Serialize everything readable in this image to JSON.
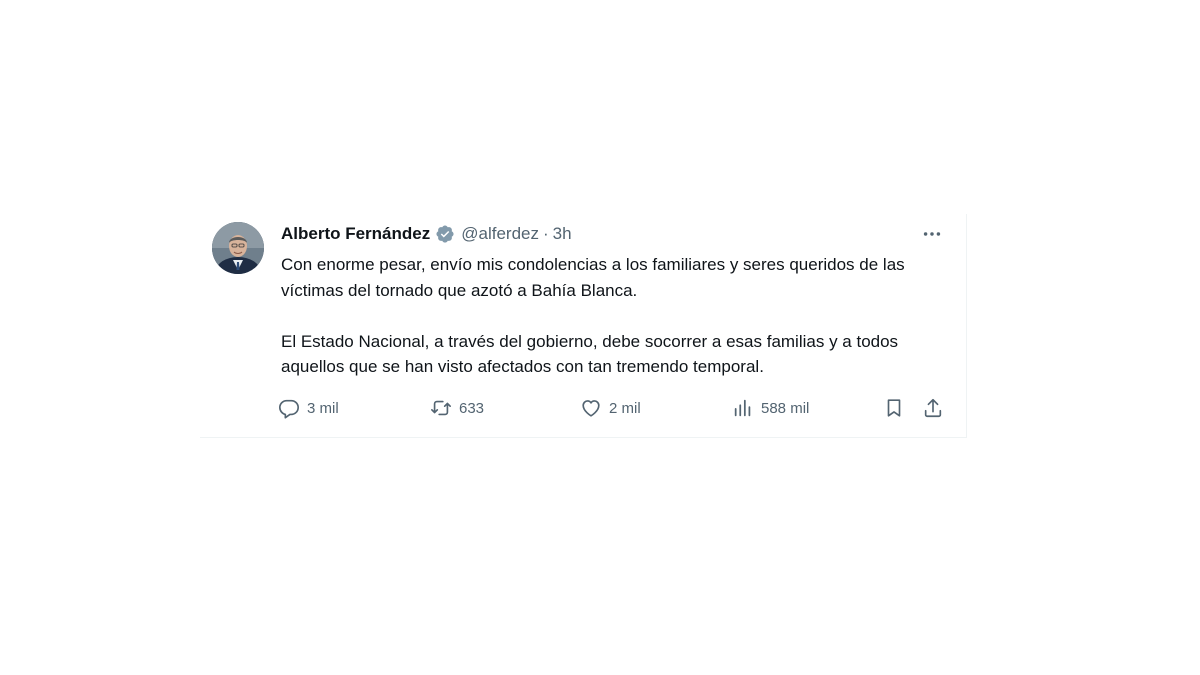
{
  "tweet": {
    "author_name": "Alberto Fernández",
    "handle": "@alferdez",
    "separator": "·",
    "time": "3h",
    "paragraphs": [
      "Con enorme pesar, envío mis condolencias a los familiares y seres queridos de las víctimas del tornado que azotó a Bahía Blanca.",
      "El Estado Nacional, a través del gobierno, debe socorrer a esas familias y a todos aquellos que se han visto afectados con tan tremendo temporal."
    ],
    "actions": {
      "replies": "3 mil",
      "retweets": "633",
      "likes": "2 mil",
      "views": "588 mil"
    }
  },
  "icons": {
    "verified": "verified-badge-icon",
    "more": "more-options-icon",
    "reply": "reply-icon",
    "retweet": "retweet-icon",
    "like": "heart-icon",
    "views": "views-chart-icon",
    "bookmark": "bookmark-icon",
    "share": "share-icon"
  },
  "colors": {
    "text": "#0f1419",
    "secondary": "#536471",
    "verified_badge": "#829aab",
    "border": "#eff3f4"
  }
}
